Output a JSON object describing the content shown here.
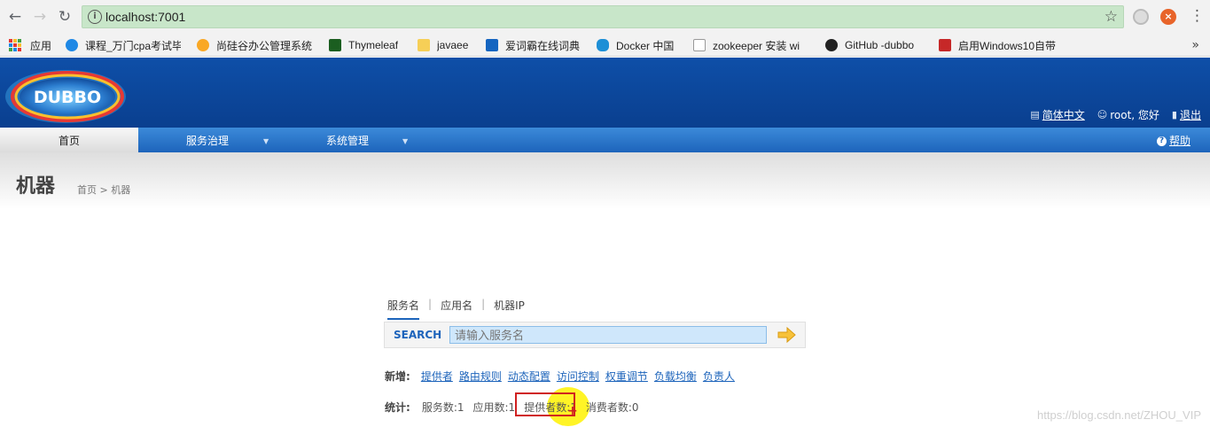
{
  "browser": {
    "url": "localhost:7001",
    "bookmarks": [
      {
        "label": "应用",
        "icon": "apps-icon"
      },
      {
        "label": "课程_万门cpa考试毕",
        "icon": "course-icon"
      },
      {
        "label": "尚硅谷办公管理系统",
        "icon": "atguigu-icon"
      },
      {
        "label": "Thymeleaf",
        "icon": "thymeleaf-icon"
      },
      {
        "label": "javaee",
        "icon": "folder-icon"
      },
      {
        "label": "爱词霸在线词典",
        "icon": "iciba-icon"
      },
      {
        "label": "Docker 中国",
        "icon": "docker-icon"
      },
      {
        "label": "zookeeper 安装 wi",
        "icon": "zookeeper-icon"
      },
      {
        "label": "GitHub -dubbo",
        "icon": "github-icon"
      },
      {
        "label": "启用Windows10自带",
        "icon": "csdn-icon"
      }
    ],
    "colors": {
      "omnibox": "#c8e6c9",
      "chrome": "#f2f2f2"
    }
  },
  "app": {
    "logo_text": "DUBBO",
    "user_links": {
      "language": "简体中文",
      "user": "root, 您好",
      "logout": "退出"
    },
    "menu": {
      "home": "首页",
      "service_governance": "服务治理",
      "system_management": "系统管理",
      "help": "帮助"
    },
    "page_title": "机器",
    "breadcrumb": "首页 > 机器",
    "colors": {
      "header": "#0e4fa8",
      "menu": "#1d64bb",
      "link": "#1d64bb"
    }
  },
  "search": {
    "tabs": [
      "服务名",
      "应用名",
      "机器IP"
    ],
    "active_tab": "服务名",
    "label": "SEARCH",
    "placeholder": "请输入服务名"
  },
  "quick_add": {
    "label": "新增:",
    "links": [
      "提供者",
      "路由规则",
      "动态配置",
      "访问控制",
      "权重调节",
      "负载均衡",
      "负责人"
    ]
  },
  "stats": {
    "label": "统计:",
    "services": "服务数:1",
    "applications": "应用数:1",
    "providers": "提供者数:1",
    "consumers": "消费者数:0"
  },
  "watermark": "https://blog.csdn.net/ZHOU_VIP"
}
